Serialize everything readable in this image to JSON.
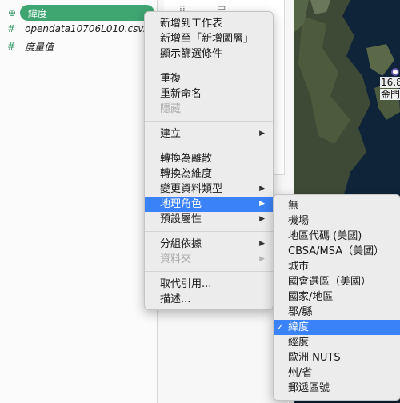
{
  "data_pane": {
    "fields": [
      {
        "icon": "globe-icon",
        "glyph": "⊕",
        "label": "緯度",
        "selected": true
      },
      {
        "icon": "hash-icon",
        "glyph": "#",
        "label": "opendata10706L010.csv...",
        "selected": false
      },
      {
        "icon": "hash-icon",
        "glyph": "#",
        "label": "度量值",
        "selected": false
      }
    ]
  },
  "map": {
    "label_value": "16,8",
    "label_place": "金門"
  },
  "context_menu": {
    "groups": [
      [
        {
          "label": "新增到工作表",
          "enabled": true,
          "submenu": false
        },
        {
          "label": "新增至「新增圖層」",
          "enabled": true,
          "submenu": false
        },
        {
          "label": "顯示篩選條件",
          "enabled": true,
          "submenu": false
        }
      ],
      [
        {
          "label": "重複",
          "enabled": true,
          "submenu": false
        },
        {
          "label": "重新命名",
          "enabled": true,
          "submenu": false
        },
        {
          "label": "隱藏",
          "enabled": false,
          "submenu": false
        }
      ],
      [
        {
          "label": "建立",
          "enabled": true,
          "submenu": true
        }
      ],
      [
        {
          "label": "轉換為離散",
          "enabled": true,
          "submenu": false
        },
        {
          "label": "轉換為維度",
          "enabled": true,
          "submenu": false
        },
        {
          "label": "變更資料類型",
          "enabled": true,
          "submenu": true
        },
        {
          "label": "地理角色",
          "enabled": true,
          "submenu": true,
          "highlighted": true
        },
        {
          "label": "預設屬性",
          "enabled": true,
          "submenu": true
        }
      ],
      [
        {
          "label": "分組依據",
          "enabled": true,
          "submenu": true
        },
        {
          "label": "資料夾",
          "enabled": false,
          "submenu": true
        }
      ],
      [
        {
          "label": "取代引用...",
          "enabled": true,
          "submenu": false
        },
        {
          "label": "描述...",
          "enabled": true,
          "submenu": false
        }
      ]
    ]
  },
  "geo_submenu": {
    "checkmark": "✓",
    "items": [
      {
        "label": "無",
        "checked": false
      },
      {
        "label": "機場",
        "checked": false
      },
      {
        "label": "地區代碼 (美國)",
        "checked": false
      },
      {
        "label": "CBSA/MSA（美國）",
        "checked": false
      },
      {
        "label": "城市",
        "checked": false
      },
      {
        "label": "國會選區（美國）",
        "checked": false
      },
      {
        "label": "國家/地區",
        "checked": false
      },
      {
        "label": "郡/縣",
        "checked": false
      },
      {
        "label": "緯度",
        "checked": true
      },
      {
        "label": "經度",
        "checked": false
      },
      {
        "label": "歐洲 NUTS",
        "checked": false
      },
      {
        "label": "州/省",
        "checked": false
      },
      {
        "label": "郵遞區號",
        "checked": false
      }
    ]
  },
  "colors": {
    "accent_green": "#3fa672",
    "highlight_blue": "#3a82f7"
  }
}
